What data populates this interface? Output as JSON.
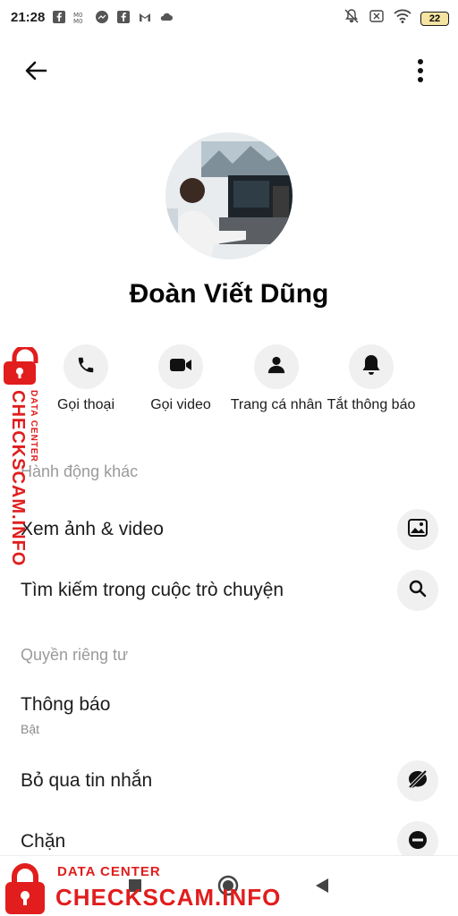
{
  "status_bar": {
    "time": "21:28",
    "battery": "22"
  },
  "header": {
    "back_icon": "arrow-left-icon",
    "more_icon": "more-vertical-icon"
  },
  "profile": {
    "name": "Đoàn Viết Dũng",
    "avatar_icon": "avatar-photo"
  },
  "actions": [
    {
      "label": "Gọi thoại",
      "icon": "phone-icon"
    },
    {
      "label": "Gọi video",
      "icon": "video-camera-icon"
    },
    {
      "label": "Trang cá nhân",
      "icon": "person-icon"
    },
    {
      "label": "Tắt thông báo",
      "icon": "bell-icon"
    }
  ],
  "sections": {
    "more_actions": "Hành động khác",
    "privacy": "Quyền riêng tư"
  },
  "rows": {
    "photos": {
      "label": "Xem ảnh & video",
      "icon": "image-icon"
    },
    "search": {
      "label": "Tìm kiếm trong cuộc trò chuyện",
      "icon": "search-icon"
    },
    "notifications": {
      "label": "Thông báo",
      "sub": "Bật"
    },
    "ignore": {
      "label": "Bỏ qua tin nhắn",
      "icon": "ignore-icon"
    },
    "block": {
      "label": "Chặn",
      "icon": "block-icon"
    }
  },
  "watermark": {
    "sub": "DATA CENTER",
    "main": "CHECKSCAM.INFO"
  },
  "colors": {
    "watermark": "#e11d1d",
    "icon_bg": "#f0f0f0"
  }
}
